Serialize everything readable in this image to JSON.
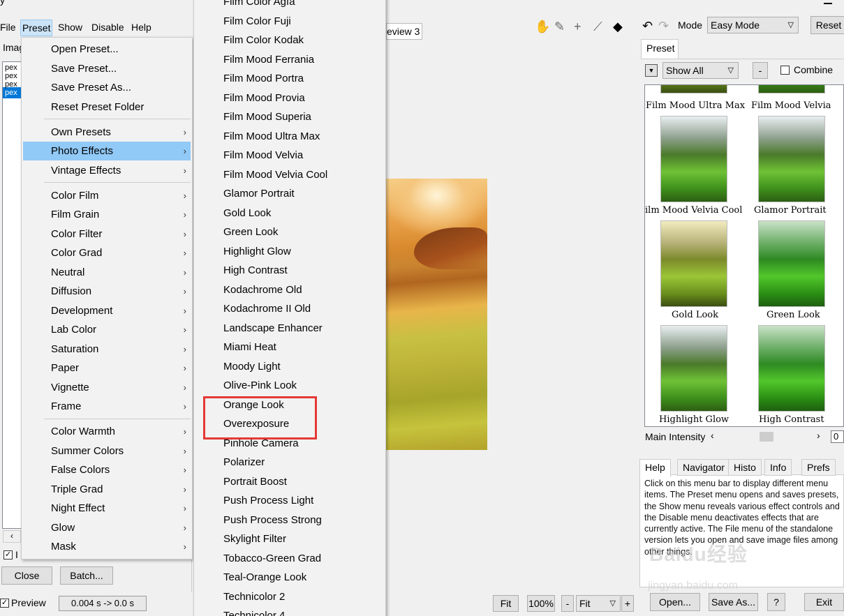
{
  "window": {
    "title_partial": "y",
    "min_icon": "minimize-icon"
  },
  "menubar": {
    "file": "File",
    "preset": "Preset",
    "show": "Show",
    "disable": "Disable",
    "help": "Help"
  },
  "left": {
    "image_tab": "Imag",
    "files": [
      "pex",
      "pex",
      "pex",
      "pex"
    ],
    "close": "Close",
    "batch": "Batch...",
    "checkbox_partial": "I"
  },
  "preset_menu": {
    "items": [
      {
        "label": "Open Preset...",
        "sub": false
      },
      {
        "label": "Save Preset...",
        "sub": false
      },
      {
        "label": "Save Preset As...",
        "sub": false
      },
      {
        "label": "Reset Preset Folder",
        "sub": false
      },
      {
        "label": "Own Presets",
        "sub": true
      },
      {
        "label": "Photo Effects",
        "sub": true,
        "highlighted": true
      },
      {
        "label": "Vintage Effects",
        "sub": true
      },
      {
        "label": "Color Film",
        "sub": true
      },
      {
        "label": "Film Grain",
        "sub": true
      },
      {
        "label": "Color Filter",
        "sub": true
      },
      {
        "label": "Color Grad",
        "sub": true
      },
      {
        "label": "Neutral",
        "sub": true
      },
      {
        "label": "Diffusion",
        "sub": true
      },
      {
        "label": "Development",
        "sub": true
      },
      {
        "label": "Lab Color",
        "sub": true
      },
      {
        "label": "Saturation",
        "sub": true
      },
      {
        "label": "Paper",
        "sub": true
      },
      {
        "label": "Vignette",
        "sub": true
      },
      {
        "label": "Frame",
        "sub": true
      },
      {
        "label": "Color Warmth",
        "sub": true
      },
      {
        "label": "Summer Colors",
        "sub": true
      },
      {
        "label": "False Colors",
        "sub": true
      },
      {
        "label": "Triple Grad",
        "sub": true
      },
      {
        "label": "Night Effect",
        "sub": true
      },
      {
        "label": "Glow",
        "sub": true
      },
      {
        "label": "Mask",
        "sub": true
      }
    ]
  },
  "photo_effects_menu": {
    "items": [
      "Film Color Agfa",
      "Film Color Fuji",
      "Film Color Kodak",
      "Film Mood Ferrania",
      "Film Mood Portra",
      "Film Mood Provia",
      "Film Mood Superia",
      "Film Mood Ultra Max",
      "Film Mood Velvia",
      "Film Mood Velvia Cool",
      "Glamor Portrait",
      "Gold Look",
      "Green Look",
      "Highlight Glow",
      "High Contrast",
      "Kodachrome Old",
      "Kodachrome II Old",
      "Landscape Enhancer",
      "Miami Heat",
      "Moody Light",
      "Olive-Pink Look",
      "Orange Look",
      "Overexposure",
      "Pinhole Camera",
      "Polarizer",
      "Portrait Boost",
      "Push Process Light",
      "Push Process Strong",
      "Skylight Filter",
      "Tobacco-Green Grad",
      "Teal-Orange Look",
      "Technicolor 2",
      "Technicolor 4"
    ],
    "annotated_item": "Overexposure"
  },
  "center": {
    "preview_tab": "eview 3",
    "fit": "Fit",
    "zoom": "100%",
    "minus": "-",
    "fit_select": "Fit",
    "plus": "+"
  },
  "right": {
    "mode_label": "Mode",
    "mode_value": "Easy Mode",
    "reset": "Reset",
    "preset_tab": "Preset",
    "show_all": "Show All",
    "dash": "-",
    "combine": "Combine",
    "thumbs_top_labels": [
      "Film Mood Ultra Max",
      "Film Mood Velvia"
    ],
    "thumb_labels": [
      "ilm Mood Velvia Cool",
      "Glamor Portrait",
      "Gold Look",
      "Green Look",
      "Highlight Glow",
      "High Contrast"
    ],
    "main_intensity": "Main Intensity",
    "intensity_value": "0",
    "tabs": [
      "Help",
      "Navigator",
      "Histo",
      "Info",
      "Prefs"
    ],
    "help_text": "Click on this menu bar to display different menu items. The Preset menu opens and saves presets, the Show menu reveals various effect controls and the Disable menu deactivates effects that are currently active. The File menu of the standalone version lets you open and save image files among other things.",
    "open": "Open...",
    "save_as": "Save As...",
    "question": "?",
    "exit": "Exit"
  },
  "status": {
    "preview": "Preview",
    "timing": "0.004 s -> 0.0 s"
  },
  "watermark": {
    "main": "Baidu经验",
    "url": "jingyan.baidu.com"
  }
}
